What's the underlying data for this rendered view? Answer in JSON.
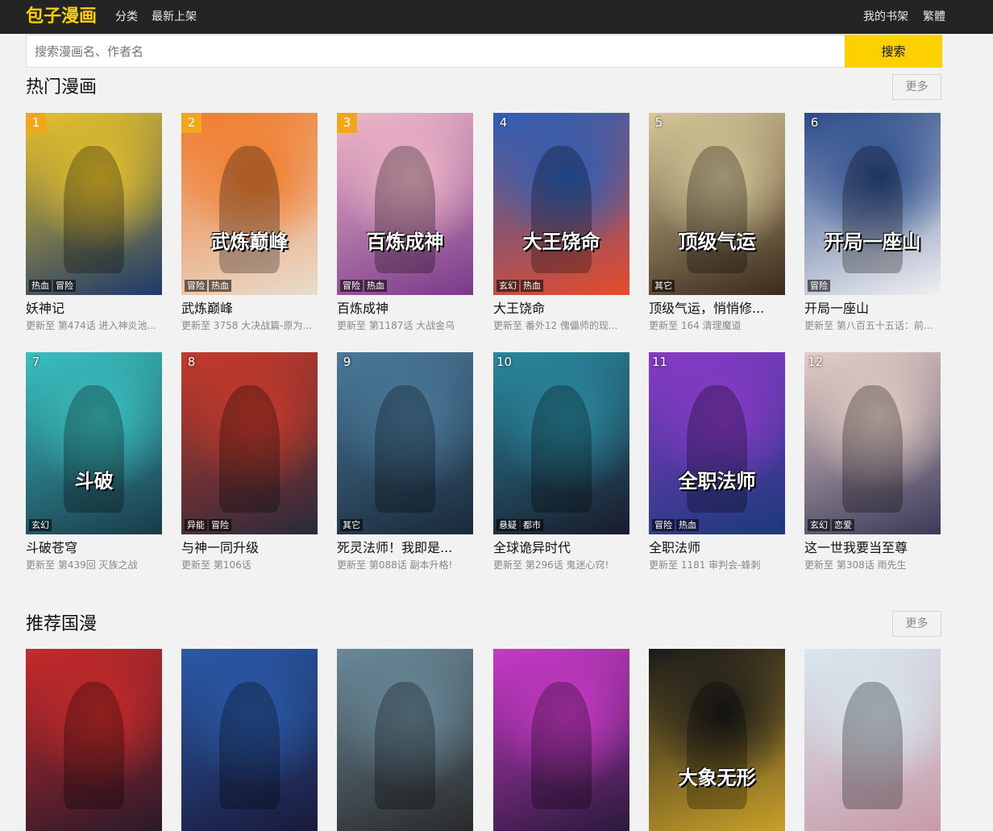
{
  "header": {
    "logo": "包子漫画",
    "nav": [
      "分类",
      "最新上架"
    ],
    "shelf": "我的书架",
    "traditional": "繁體"
  },
  "search": {
    "placeholder": "搜索漫画名、作者名",
    "button": "搜索"
  },
  "hot": {
    "title": "热门漫画",
    "more": "更多",
    "items": [
      {
        "rank": "1",
        "title": "妖神记",
        "update": "更新至 第474话 进入神炎池...",
        "tags": [
          "热血",
          "冒险"
        ],
        "colors": [
          "#e9c22a",
          "#1d3a6b"
        ]
      },
      {
        "rank": "2",
        "title": "武炼巅峰",
        "update": "更新至 3758 大决战篇-原为...",
        "tags": [
          "冒险",
          "热血"
        ],
        "colors": [
          "#f07a2a",
          "#e8dccf"
        ],
        "cover_text": "武炼巅峰"
      },
      {
        "rank": "3",
        "title": "百炼成神",
        "update": "更新至 第1187话 大战金乌",
        "tags": [
          "冒险",
          "热血"
        ],
        "colors": [
          "#f0b8c8",
          "#7a3a8a"
        ],
        "cover_text": "百炼成神"
      },
      {
        "rank": "4",
        "title": "大王饶命",
        "update": "更新至 番外12 傀儡师的现...",
        "tags": [
          "玄幻",
          "热血"
        ],
        "colors": [
          "#2a5fb8",
          "#e64b2a"
        ],
        "cover_text": "大王饶命"
      },
      {
        "rank": "5",
        "title": "顶级气运，悄悄修...",
        "update": "更新至 164 清理魔道",
        "tags": [
          "其它"
        ],
        "colors": [
          "#d8c89a",
          "#3a2a1a"
        ],
        "cover_text": "顶级气运"
      },
      {
        "rank": "6",
        "title": "开局一座山",
        "update": "更新至 第八百五十五话：前...",
        "tags": [
          "冒险"
        ],
        "colors": [
          "#2a4a8a",
          "#f0f0f0"
        ],
        "cover_text": "开局一座山"
      },
      {
        "rank": "7",
        "title": "斗破苍穹",
        "update": "更新至 第439回 灭族之战",
        "tags": [
          "玄幻"
        ],
        "colors": [
          "#3ac0c0",
          "#1a3a4a"
        ],
        "cover_text": "斗破"
      },
      {
        "rank": "8",
        "title": "与神一同升级",
        "update": "更新至 第106话",
        "tags": [
          "异能",
          "冒险"
        ],
        "colors": [
          "#c83a2a",
          "#2a2a3a"
        ]
      },
      {
        "rank": "9",
        "title": "死灵法师！我即是...",
        "update": "更新至 第088话 副本升格!",
        "tags": [
          "其它"
        ],
        "colors": [
          "#4a7a9a",
          "#1a2a3a"
        ]
      },
      {
        "rank": "10",
        "title": "全球诡异时代",
        "update": "更新至 第296话 鬼迷心窍!",
        "tags": [
          "悬疑",
          "都市"
        ],
        "colors": [
          "#2a8aa0",
          "#1a1a2a"
        ]
      },
      {
        "rank": "11",
        "title": "全职法师",
        "update": "更新至 1181 审判会-蜂刺",
        "tags": [
          "冒险",
          "热血"
        ],
        "colors": [
          "#8a3ac8",
          "#1a3a7a"
        ],
        "cover_text": "全职法师"
      },
      {
        "rank": "12",
        "title": "这一世我要当至尊",
        "update": "更新至 第308话 雨先生",
        "tags": [
          "玄幻",
          "恋爱"
        ],
        "colors": [
          "#e8d0c8",
          "#3a3a5a"
        ]
      }
    ]
  },
  "recommend": {
    "title": "推荐国漫",
    "more": "更多",
    "items": [
      {
        "colors": [
          "#c82a2a",
          "#2a1a2a"
        ]
      },
      {
        "colors": [
          "#2a5aa8",
          "#1a1a3a"
        ]
      },
      {
        "colors": [
          "#6a8a9a",
          "#2a2a2a"
        ]
      },
      {
        "colors": [
          "#c83ac8",
          "#2a1a3a"
        ]
      },
      {
        "colors": [
          "#1a1a1a",
          "#c8a02a"
        ],
        "cover_text": "大象无形"
      },
      {
        "colors": [
          "#d8e8f0",
          "#c89aa8"
        ]
      }
    ]
  }
}
